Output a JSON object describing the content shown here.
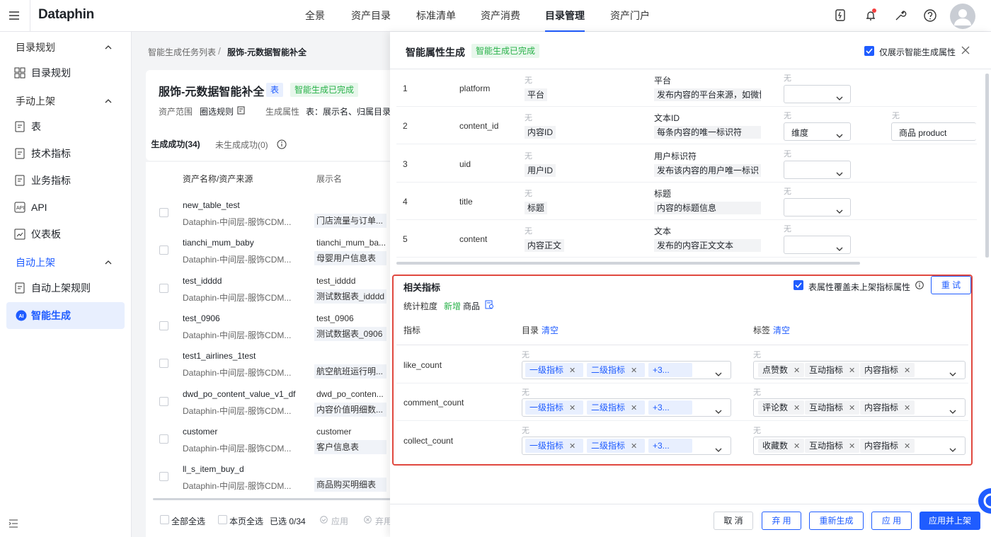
{
  "brand": "Dataphin",
  "nav": [
    "全景",
    "资产目录",
    "标准清单",
    "资产消费",
    "目录管理",
    "资产门户"
  ],
  "nav_active": "目录管理",
  "sidebar": {
    "group1": "目录规划",
    "item_catalog": "目录规划",
    "group2": "手动上架",
    "item_table": "表",
    "item_tech": "技术指标",
    "item_biz": "业务指标",
    "item_api": "API",
    "item_dash": "仪表板",
    "group3": "自动上架",
    "item_rule": "自动上架规则",
    "item_ai": "智能生成",
    "ai_badge": "AI"
  },
  "breadcrumb": {
    "parent": "智能生成任务列表",
    "sep": "/",
    "current": "服饰-元数据智能补全"
  },
  "task": {
    "title": "服饰-元数据智能补全",
    "type_tag": "表",
    "status": "智能生成已完成",
    "scope_label": "资产范围",
    "scope_value": "圈选规则",
    "attr_label": "生成属性",
    "attr_value": "表：展示名、归属目录、"
  },
  "tabs": {
    "success": "生成成功(34)",
    "fail": "未生成成功(0)"
  },
  "table": {
    "col_name": "资产名称/资产来源",
    "col_display": "展示名",
    "rows": [
      {
        "name": "new_table_test",
        "src": "Dataphin-中间层-服饰CDM...",
        "disp": "",
        "tag": "门店流量与订单..."
      },
      {
        "name": "tianchi_mum_baby",
        "src": "Dataphin-中间层-服饰CDM...",
        "disp": "tianchi_mum_ba...",
        "tag": "母婴用户信息表"
      },
      {
        "name": "test_idddd",
        "src": "Dataphin-中间层-服饰CDM...",
        "disp": "test_idddd",
        "tag": "测试数据表_idddd"
      },
      {
        "name": "test_0906",
        "src": "Dataphin-中间层-服饰CDM...",
        "disp": "test_0906",
        "tag": "测试数据表_0906"
      },
      {
        "name": "test1_airlines_1test",
        "src": "Dataphin-中间层-服饰CDM...",
        "disp": "",
        "tag": "航空航班运行明..."
      },
      {
        "name": "dwd_po_content_value_v1_df",
        "src": "Dataphin-中间层-服饰CDM...",
        "disp": "dwd_po_conten...",
        "tag": "内容价值明细数..."
      },
      {
        "name": "customer",
        "src": "Dataphin-中间层-服饰CDM...",
        "disp": "customer",
        "tag": "客户信息表"
      },
      {
        "name": "ll_s_item_buy_d",
        "src": "Dataphin-中间层-服饰CDM...",
        "disp": "",
        "tag": "商品购买明细表"
      }
    ]
  },
  "footer": {
    "select_all": "全部全选",
    "select_page": "本页全选",
    "selected": "已选 0/34",
    "apply": "应用",
    "discard": "弃用"
  },
  "panel": {
    "title": "智能属性生成",
    "status": "智能生成已完成",
    "only_show": "仅展示智能生成属性",
    "none": "无",
    "fields": [
      {
        "no": "1",
        "col": "platform",
        "old": "平台",
        "label": "平台",
        "desc": "发布内容的平台来源，如微博",
        "sel": "",
        "extra": ""
      },
      {
        "no": "2",
        "col": "content_id",
        "old": "内容ID",
        "label": "文本ID",
        "desc": "每条内容的唯一标识符",
        "sel": "维度",
        "extra": "商品 product"
      },
      {
        "no": "3",
        "col": "uid",
        "old": "用户ID",
        "label": "用户标识符",
        "desc": "发布该内容的用户唯一标识",
        "sel": "",
        "extra": ""
      },
      {
        "no": "4",
        "col": "title",
        "old": "标题",
        "label": "标题",
        "desc": "内容的标题信息",
        "sel": "",
        "extra": ""
      },
      {
        "no": "5",
        "col": "content",
        "old": "内容正文",
        "label": "文本",
        "desc": "发布的内容正文文本",
        "sel": "",
        "extra": ""
      }
    ],
    "metrics": {
      "title": "相关指标",
      "override": "表属性覆盖未上架指标属性",
      "retry": "重 试",
      "grain_label": "统计粒度",
      "grain_new": "新增",
      "grain_value": "商品",
      "col_metric": "指标",
      "col_dir": "目录",
      "col_tag": "标签",
      "clear": "清空",
      "rows": [
        {
          "name": "like_count",
          "dirs": [
            "一级指标",
            "二级指标",
            "+3..."
          ],
          "tags": [
            "点赞数",
            "互动指标",
            "内容指标"
          ]
        },
        {
          "name": "comment_count",
          "dirs": [
            "一级指标",
            "二级指标",
            "+3..."
          ],
          "tags": [
            "评论数",
            "互动指标",
            "内容指标"
          ]
        },
        {
          "name": "collect_count",
          "dirs": [
            "一级指标",
            "二级指标",
            "+3..."
          ],
          "tags": [
            "收藏数",
            "互动指标",
            "内容指标"
          ]
        }
      ]
    },
    "buttons": {
      "cancel": "取 消",
      "discard": "弃 用",
      "regen": "重新生成",
      "apply": "应 用",
      "apply_publish": "应用并上架"
    }
  },
  "colors": {
    "accent": "#1f5cff",
    "success": "#27b148",
    "highlight_border": "#e0483f"
  }
}
